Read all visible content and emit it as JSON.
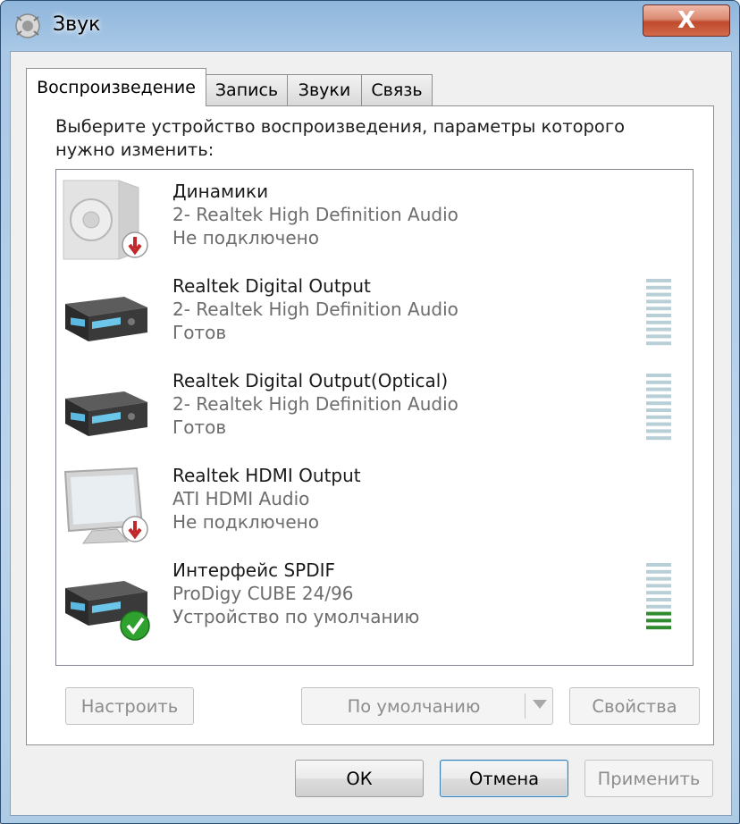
{
  "window": {
    "title": "Звук",
    "close_label": "X"
  },
  "tabs": [
    {
      "label": "Воспроизведение",
      "active": true
    },
    {
      "label": "Запись",
      "active": false
    },
    {
      "label": "Звуки",
      "active": false
    },
    {
      "label": "Связь",
      "active": false
    }
  ],
  "instruction": "Выберите устройство воспроизведения, параметры которого нужно изменить:",
  "devices": [
    {
      "name": "Динамики",
      "driver": "2- Realtek High Definition Audio",
      "status": "Не подключено",
      "icon": "speaker-icon",
      "badge": "disconnected-badge-icon",
      "meter_active": 0
    },
    {
      "name": "Realtek Digital Output",
      "driver": "2- Realtek High Definition Audio",
      "status": "Готов",
      "icon": "receiver-icon",
      "badge": "",
      "meter_active": 0
    },
    {
      "name": "Realtek Digital Output(Optical)",
      "driver": "2- Realtek High Definition Audio",
      "status": "Готов",
      "icon": "receiver-icon",
      "badge": "",
      "meter_active": 0
    },
    {
      "name": "Realtek HDMI Output",
      "driver": "ATI HDMI Audio",
      "status": "Не подключено",
      "icon": "monitor-icon",
      "badge": "disconnected-badge-icon",
      "meter_active": 0
    },
    {
      "name": "Интерфейс SPDIF",
      "driver": "ProDigy CUBE 24/96",
      "status": "Устройство по умолчанию",
      "icon": "receiver-icon",
      "badge": "default-check-badge-icon",
      "meter_active": 3
    }
  ],
  "buttons": {
    "configure": "Настроить",
    "set_default": "По умолчанию",
    "properties": "Свойства",
    "ok": "ОК",
    "cancel": "Отмена",
    "apply": "Применить"
  },
  "colors": {
    "meter_idle": "#b8cfd8",
    "meter_active": "#2e8b2e",
    "badge_red": "#c0282a",
    "badge_green": "#2ea12e"
  }
}
